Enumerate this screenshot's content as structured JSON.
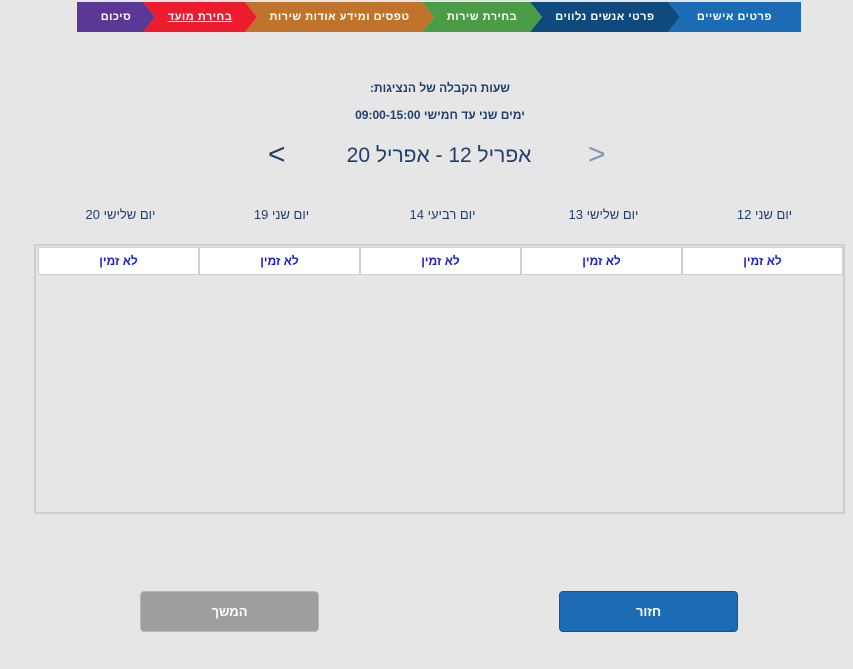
{
  "steps": [
    {
      "label": "פרטים אישיים"
    },
    {
      "label": "פרטי אנשים נלווים"
    },
    {
      "label": "בחירת שירות"
    },
    {
      "label": "טפסים ומידע אודות שירות"
    },
    {
      "label": "בחירת מועד"
    },
    {
      "label": "סיכום"
    }
  ],
  "info": {
    "hours_title": "שעות הקבלה של הנציגות:",
    "hours_text": "ימים שני עד חמישי 09:00-15:00"
  },
  "week": {
    "range_label": "אפריל 12 - אפריל 20",
    "prev_arrow": ">",
    "next_arrow": "<"
  },
  "days": [
    {
      "label": "יום שני 12",
      "slot": "לא זמין"
    },
    {
      "label": "יום שלישי 13",
      "slot": "לא זמין"
    },
    {
      "label": "יום רביעי 14",
      "slot": "לא זמין"
    },
    {
      "label": "יום שני 19",
      "slot": "לא זמין"
    },
    {
      "label": "יום שלישי 20",
      "slot": "לא זמין"
    }
  ],
  "buttons": {
    "back": "חזור",
    "continue": "המשך"
  },
  "colors": {
    "step_personal": "#1b6bb5",
    "step_companions": "#0f4a7e",
    "step_service": "#4a9d46",
    "step_forms": "#c0732a",
    "step_date_active": "#ec1c2e",
    "step_summary": "#5b3795",
    "primary_button": "#1b6bb5",
    "disabled_button": "#9e9e9e",
    "unavailable_text": "#1b1bd6"
  }
}
